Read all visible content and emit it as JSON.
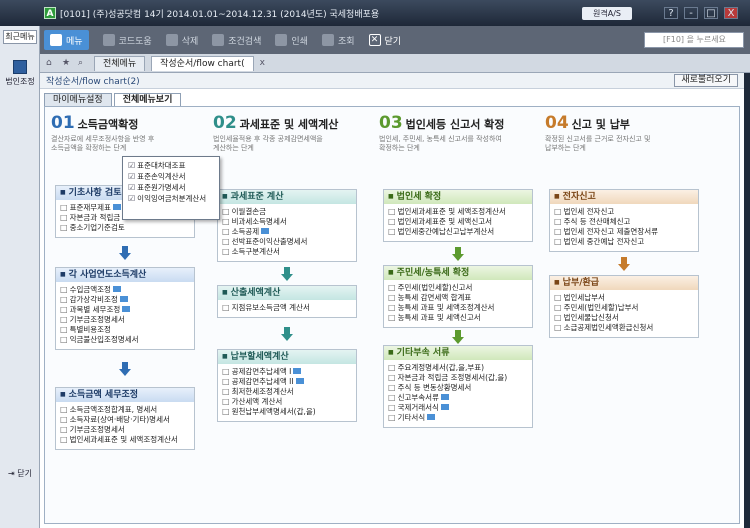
{
  "window": {
    "logo": "A",
    "title": "[0101] (주)성공닷컴    14기  2014.01.01~2014.12.31 (2014년도)  국세청배포용",
    "remote_btn": "원격A/S",
    "controls": [
      "?",
      "-",
      "□",
      "X"
    ]
  },
  "left_sidebar": {
    "recent_label": "최근메뉴",
    "corp_label": "법인조정",
    "close_label": "닫기"
  },
  "toolbar": {
    "menu": "메뉴",
    "code_help": "코드도움",
    "delete": "삭제",
    "condition_search": "조건검색",
    "print": "인쇄",
    "inquiry": "조회",
    "close": "닫기",
    "search_placeholder": "[F10] 을 누르세요"
  },
  "tabs": {
    "all_menu": "전체메뉴",
    "active": "작성순서/flow chart(",
    "close_x": "x"
  },
  "content": {
    "header_title": "작성순서/flow chart(2)",
    "reload_button": "새로불러오기",
    "subtab_my": "마이메뉴설정",
    "subtab_all": "전체메뉴보기"
  },
  "steps": [
    {
      "num": "01",
      "title": "소득금액확정",
      "desc": "결산자료에 세무조정사항을 반영 후\n소득금액을 확정하는 단계",
      "color": "#2f6db3",
      "boxes": [
        {
          "title": "기초사항 검토",
          "items": [
            "표준재무제표",
            "자본금과 적립금",
            "중소기업기준검토"
          ],
          "badges": [
            0,
            1
          ]
        },
        {
          "title": "각 사업연도소득계산",
          "items": [
            "수입금액조정",
            "감가상각비조정",
            "과목별 세무조정",
            "기부금조정명세서",
            "특별비용조정",
            "익금불산입조정명세서"
          ],
          "badges": [
            0,
            1,
            2
          ]
        },
        {
          "title": "소득금액 세무조정",
          "items": [
            "소득금액조정합계표, 명세서",
            "소득자료(상여·배당·기타)명세서",
            "기부금조정명세서",
            "법인세과세표준 및 세액조정계산서"
          ],
          "badges": []
        }
      ]
    },
    {
      "num": "02",
      "title": "과세표준 및 세액계산",
      "desc": "법인세율적용 후 각종 공제감면세액을\n계산하는 단계",
      "color": "#2f8f8a",
      "boxes": [
        {
          "title": "과세표준 계산",
          "items": [
            "이월결손금",
            "비과세소득명세서",
            "소득공제",
            "선박표준이익산출명세서",
            "소득구분계산서"
          ],
          "badges": [
            2
          ]
        },
        {
          "title": "산출세액계산",
          "items": [
            "지점유보소득금액 계산서"
          ],
          "badges": []
        },
        {
          "title": "납부할세액계산",
          "items": [
            "공제감면추납세액 I",
            "공제감면추납세액 II",
            "최저한세조정계산서",
            "가산세액 계산서",
            "원천납부세액명세서(갑,을)"
          ],
          "badges": [
            0,
            1
          ]
        }
      ]
    },
    {
      "num": "03",
      "title": "법인세등 신고서 확정",
      "desc": "법인세, 주민세, 농특세 신고서를 작성하여\n확정하는 단계",
      "color": "#5c9a2f",
      "boxes": [
        {
          "title": "법인세 확정",
          "items": [
            "법인세과세표준 및 세액조정계산서",
            "법인세과세표준 및 세액신고서",
            "법인세중간예납신고납부계산서"
          ],
          "badges": []
        },
        {
          "title": "주민세/농특세 확정",
          "items": [
            "주민세(법인세할)신고서",
            "농특세 감면세액 합계표",
            "농특세 과표 및 세액조정계산서",
            "농특세 과표 및 세액신고서"
          ],
          "badges": []
        },
        {
          "title": "기타부속 서류",
          "items": [
            "주요계정명세서(갑,을,부표)",
            "자본금과 적립금 조정명세서(갑,을)",
            "주식 등 변동상황명세서",
            "신고부속서류",
            "국제거래서식",
            "기타서식"
          ],
          "badges": [
            3,
            4,
            5
          ]
        }
      ]
    },
    {
      "num": "04",
      "title": "신고 및 납부",
      "desc": "확정된 신고서를 근거로 전자신고 및\n납부하는 단계",
      "color": "#c67b2b",
      "boxes": [
        {
          "title": "전자신고",
          "items": [
            "법인세 전자신고",
            "주식 등 전산매체신고",
            "법인세 전자신고 제출연장서류",
            "법인세 중간예납 전자신고"
          ],
          "badges": []
        },
        {
          "title": "납부/환급",
          "items": [
            "법인세납부서",
            "주민세(법인세할)납부서",
            "법인세물납신청서",
            "소급공제법인세액환급신청서"
          ],
          "badges": []
        }
      ]
    }
  ],
  "popup": {
    "items": [
      "표준대차대조표",
      "표준손익계산서",
      "표준원가명세서",
      "이익잉여금처분계산서"
    ]
  }
}
